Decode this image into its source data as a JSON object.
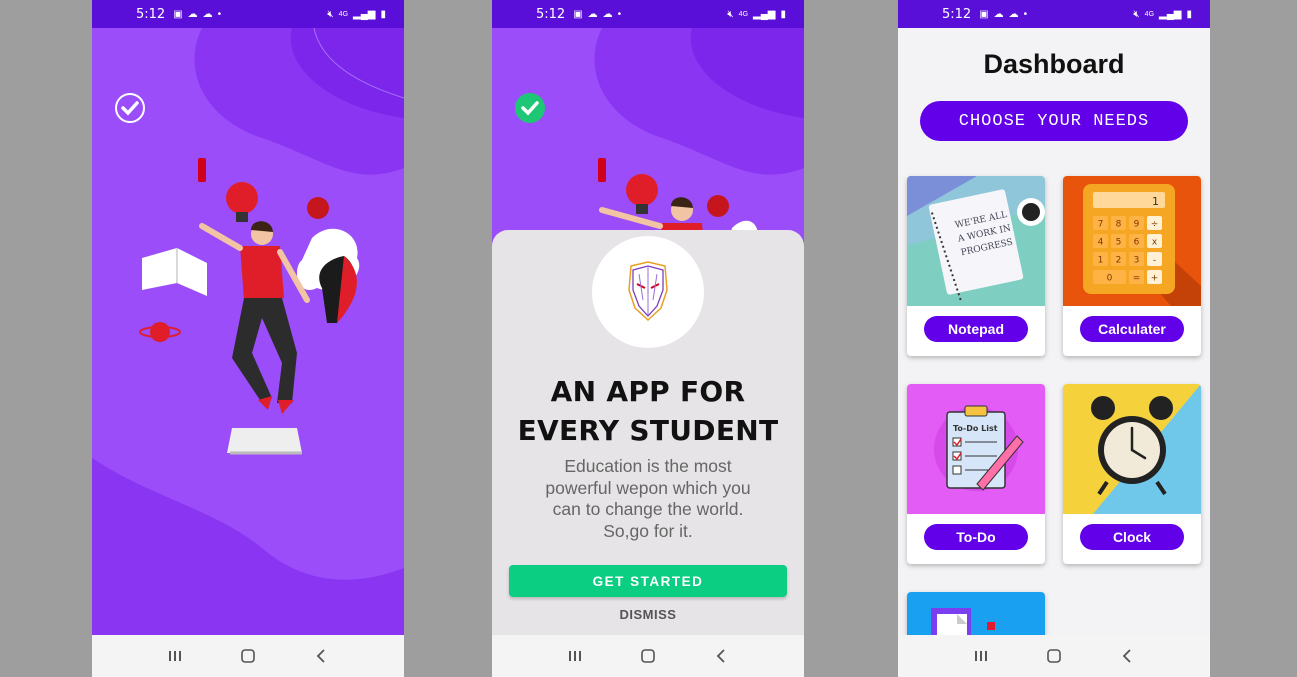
{
  "status_bar": {
    "time": "5:12",
    "left_icons": [
      "image-icon",
      "cloud-icon",
      "cloud-icon",
      "dot-icon"
    ],
    "right_icons": [
      "mute-icon",
      "4g-icon",
      "signal-icon",
      "battery-icon"
    ],
    "network_label": "4G",
    "color": "#5a0fd8"
  },
  "splash": {
    "background_color": "#9b4dfa",
    "check_color": "#ffffff"
  },
  "intro_modal": {
    "title_line1": "AN APP FOR",
    "title_line2": "EVERY STUDENT",
    "description": "Education is the most powerful wepon which you can to change the world. So,go for it.",
    "primary_button": "GET STARTED",
    "secondary_button": "DISMISS",
    "primary_color": "#0bce82",
    "check_color": "#1ec776"
  },
  "dashboard": {
    "title": "Dashboard",
    "choose_button": "CHOOSE YOUR NEEDS",
    "accent_color": "#6200ea",
    "cards": [
      {
        "label": "Notepad",
        "image": "notebook-illustration",
        "notebook_text": "WE'RE ALL A WORK IN PROGRESS"
      },
      {
        "label": "Calculater",
        "image": "calculator-illustration",
        "display": "1",
        "keys": [
          "7",
          "8",
          "9",
          "÷",
          "4",
          "5",
          "6",
          "x",
          "1",
          "2",
          "3",
          "-",
          "0",
          "=",
          "+"
        ]
      },
      {
        "label": "To-Do",
        "image": "todo-list-illustration",
        "sheet_title": "To-Do List"
      },
      {
        "label": "Clock",
        "image": "alarm-clock-illustration"
      }
    ]
  },
  "nav_bar": {
    "buttons": [
      "recents-icon",
      "home-icon",
      "back-icon"
    ]
  }
}
